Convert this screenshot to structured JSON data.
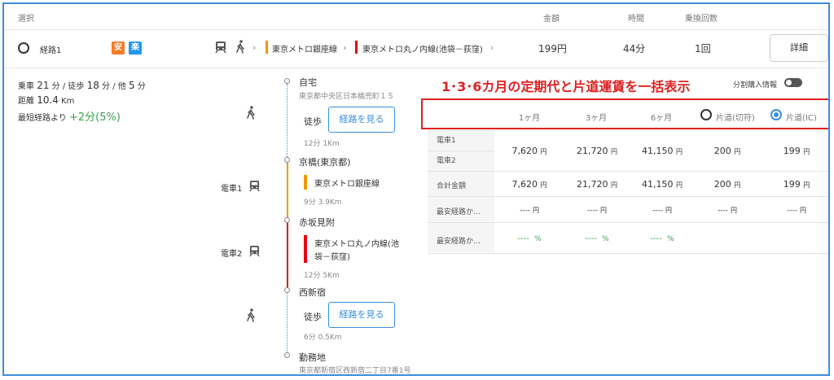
{
  "header": {
    "select_label": "選択",
    "fare_label": "金額",
    "time_label": "時間",
    "transfers_label": "乗換回数"
  },
  "route": {
    "name": "経路1",
    "badge_safe": "安",
    "badge_easy": "楽",
    "line1": "東京メトロ銀座線",
    "line2": "東京メトロ丸ノ内線(池袋－荻窪)",
    "fare": "199円",
    "time": "44分",
    "transfers": "1回",
    "detail_button": "詳細"
  },
  "summary": {
    "train_prefix": "乗車",
    "train_min": "21",
    "walk_prefix": "分 / 徒歩",
    "walk_min": "18",
    "other_prefix": "分 / 他",
    "other_min": "5",
    "min_unit": "分",
    "distance_label": "距離",
    "distance_value": "10.4",
    "distance_unit": "Km",
    "shortest_label": "最短経路より",
    "shortest_diff": "+2分(5%)"
  },
  "timeline": {
    "start_name": "自宅",
    "start_address": "東京都中央区日本橋兜町１５",
    "walk1_label": "徒歩",
    "walk1_button": "経路を見る",
    "walk1_info": "12分 1Km",
    "station1": "京橋(東京都)",
    "train1_label": "電車1",
    "train1_line": "東京メトロ銀座線",
    "train1_info": "9分 3.9Km",
    "station2": "赤坂見附",
    "train2_label": "電車2",
    "train2_line_a": "東京メトロ丸ノ内線(池",
    "train2_line_b": "袋－荻窪)",
    "train2_info": "12分 5Km",
    "station3": "西新宿",
    "walk2_label": "徒歩",
    "walk2_button": "経路を見る",
    "walk2_info": "6分 0.5Km",
    "end_name": "勤務地",
    "end_address": "東京都新宿区西新宿二丁目7番1号"
  },
  "annotation": "1･3･6カ月の定期代と片道運賃を一括表示",
  "installment_label": "分割購入情報",
  "fare_table": {
    "col_1m": "1ヶ月",
    "col_3m": "3ヶ月",
    "col_6m": "6ヶ月",
    "col_ticket": "片道(切符)",
    "col_ic": "片道(IC)",
    "row_train1": "電車1",
    "row_train2": "電車2",
    "row_total": "合計金額",
    "row_cheapest1": "最安経路か…",
    "row_cheapest2": "最安経路か…",
    "yen": "円",
    "pct": "%",
    "dash": "----",
    "train_1m": "7,620",
    "train_3m": "21,720",
    "train_6m": "41,150",
    "train_ticket": "200",
    "train_ic": "199",
    "total_1m": "7,620",
    "total_3m": "21,720",
    "total_6m": "41,150",
    "total_ticket": "200",
    "total_ic": "199"
  },
  "colors": {
    "frame_blue": "#3b8ee0",
    "ginza_orange": "#f39700",
    "marunouchi_red": "#e60012",
    "badge_orange": "#f57c2a",
    "badge_blue": "#2196f3",
    "annotation_red": "#e02020",
    "green": "#3aa24a"
  }
}
